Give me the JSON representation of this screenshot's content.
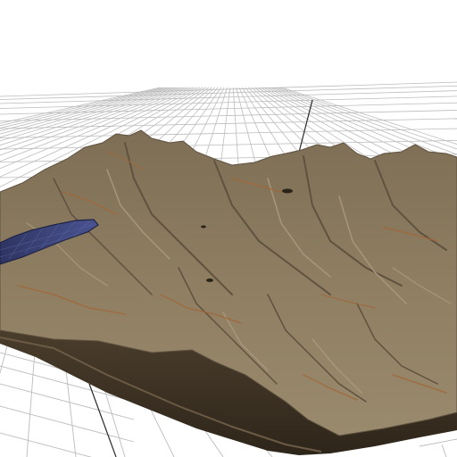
{
  "viewport": {
    "background": "#ffffff"
  },
  "ground_grid": {
    "line_color": "#bcbcbc",
    "dark_line_color": "#2a2a2a"
  },
  "terrain": {
    "surface_color": "#8f7e62",
    "ridge_color": "#a8967a",
    "shadow_color": "#5f5240",
    "rust_vein_color": "#a0683a",
    "base_side_color": "#3a2f22",
    "base_stripe_color": "#6b5a44",
    "lake_color": "#3a4272",
    "lake_highlight_color": "#5a63a0"
  }
}
